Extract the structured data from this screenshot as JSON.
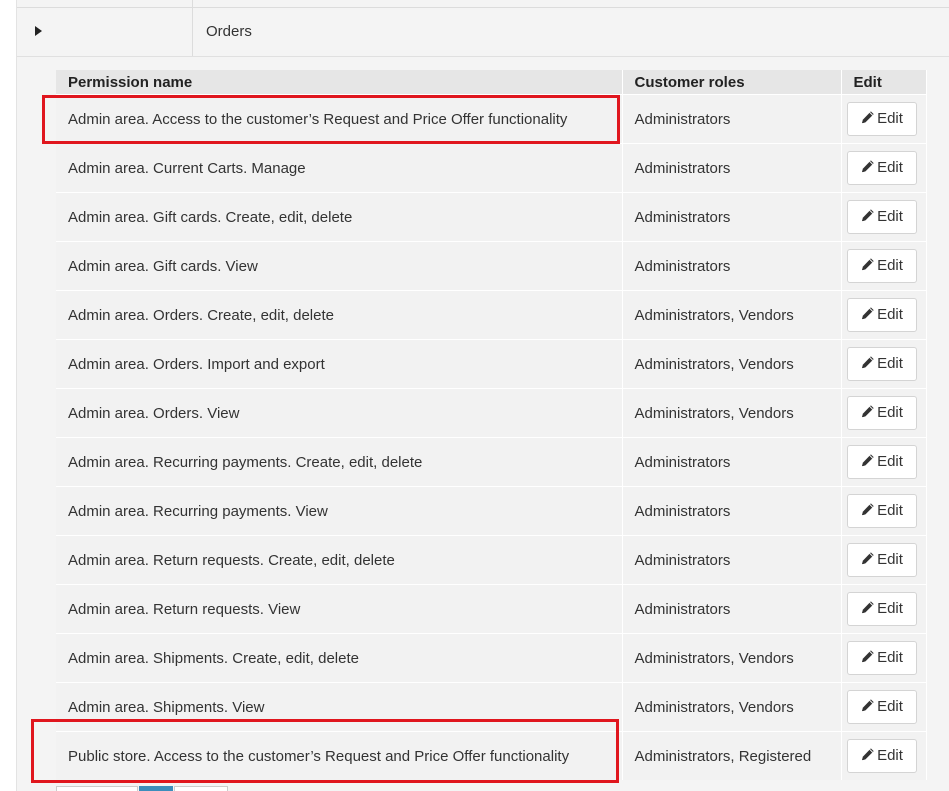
{
  "group": {
    "name": "Orders"
  },
  "table": {
    "headers": {
      "permission": "Permission name",
      "roles": "Customer roles",
      "edit": "Edit"
    },
    "edit_label": "Edit",
    "rows": [
      {
        "permission": "Admin area. Access to the customer’s Request and Price Offer functionality",
        "roles": "Administrators"
      },
      {
        "permission": "Admin area. Current Carts. Manage",
        "roles": "Administrators"
      },
      {
        "permission": "Admin area. Gift cards. Create, edit, delete",
        "roles": "Administrators"
      },
      {
        "permission": "Admin area. Gift cards. View",
        "roles": "Administrators"
      },
      {
        "permission": "Admin area. Orders. Create, edit, delete",
        "roles": "Administrators, Vendors"
      },
      {
        "permission": "Admin area. Orders. Import and export",
        "roles": "Administrators, Vendors"
      },
      {
        "permission": "Admin area. Orders. View",
        "roles": "Administrators, Vendors"
      },
      {
        "permission": "Admin area. Recurring payments. Create, edit, delete",
        "roles": "Administrators"
      },
      {
        "permission": "Admin area. Recurring payments. View",
        "roles": "Administrators"
      },
      {
        "permission": "Admin area. Return requests. Create, edit, delete",
        "roles": "Administrators"
      },
      {
        "permission": "Admin area. Return requests. View",
        "roles": "Administrators"
      },
      {
        "permission": "Admin area. Shipments. Create, edit, delete",
        "roles": "Administrators, Vendors"
      },
      {
        "permission": "Admin area. Shipments. View",
        "roles": "Administrators, Vendors"
      },
      {
        "permission": "Public store. Access to the customer’s Request and Price Offer functionality",
        "roles": "Administrators, Registered"
      }
    ]
  },
  "colors": {
    "highlight": "#e0161e",
    "header_bg": "#e6e6e6",
    "row_bg": "#f2f2f2"
  },
  "icons": {
    "expand": "expand-arrow-icon",
    "edit": "pencil-icon"
  }
}
